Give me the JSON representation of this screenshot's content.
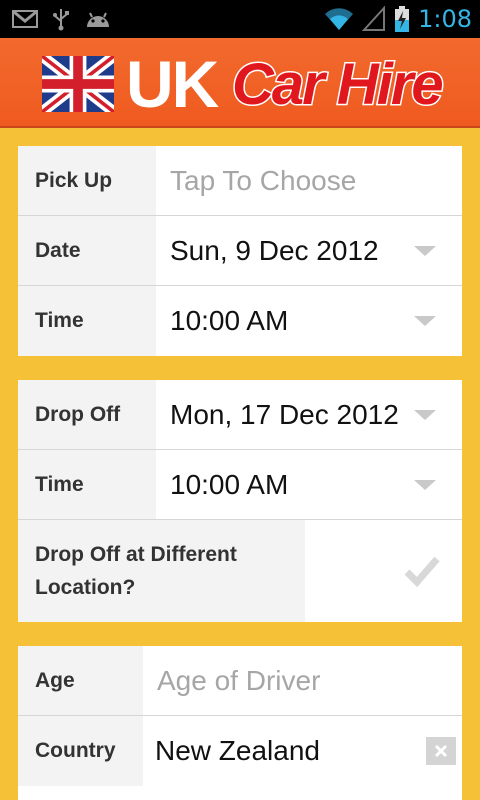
{
  "status_bar": {
    "time": "1:08",
    "icons_left": [
      "gmail-icon",
      "usb-icon",
      "android-icon"
    ],
    "icons_right": [
      "wifi-icon",
      "signal-icon",
      "battery-icon"
    ]
  },
  "header": {
    "brand_uk": "UK",
    "brand_car": "Car Hire"
  },
  "pickup_panel": {
    "pick_up_label": "Pick Up",
    "pick_up_placeholder": "Tap To Choose",
    "date_label": "Date",
    "date_value": "Sun, 9 Dec 2012",
    "time_label": "Time",
    "time_value": "10:00 AM"
  },
  "dropoff_panel": {
    "drop_off_label": "Drop Off",
    "drop_off_value": "Mon, 17 Dec 2012",
    "time_label": "Time",
    "time_value": "10:00 AM",
    "different_location_label_line1": "Drop Off at Different",
    "different_location_label_line2": "Location?",
    "different_location_checked": false
  },
  "driver_panel": {
    "age_label": "Age",
    "age_placeholder": "Age of Driver",
    "country_label": "Country",
    "country_value": "New Zealand"
  },
  "colors": {
    "background": "#f5c136",
    "header": "#f26a2e",
    "status_time": "#33b5e5"
  }
}
